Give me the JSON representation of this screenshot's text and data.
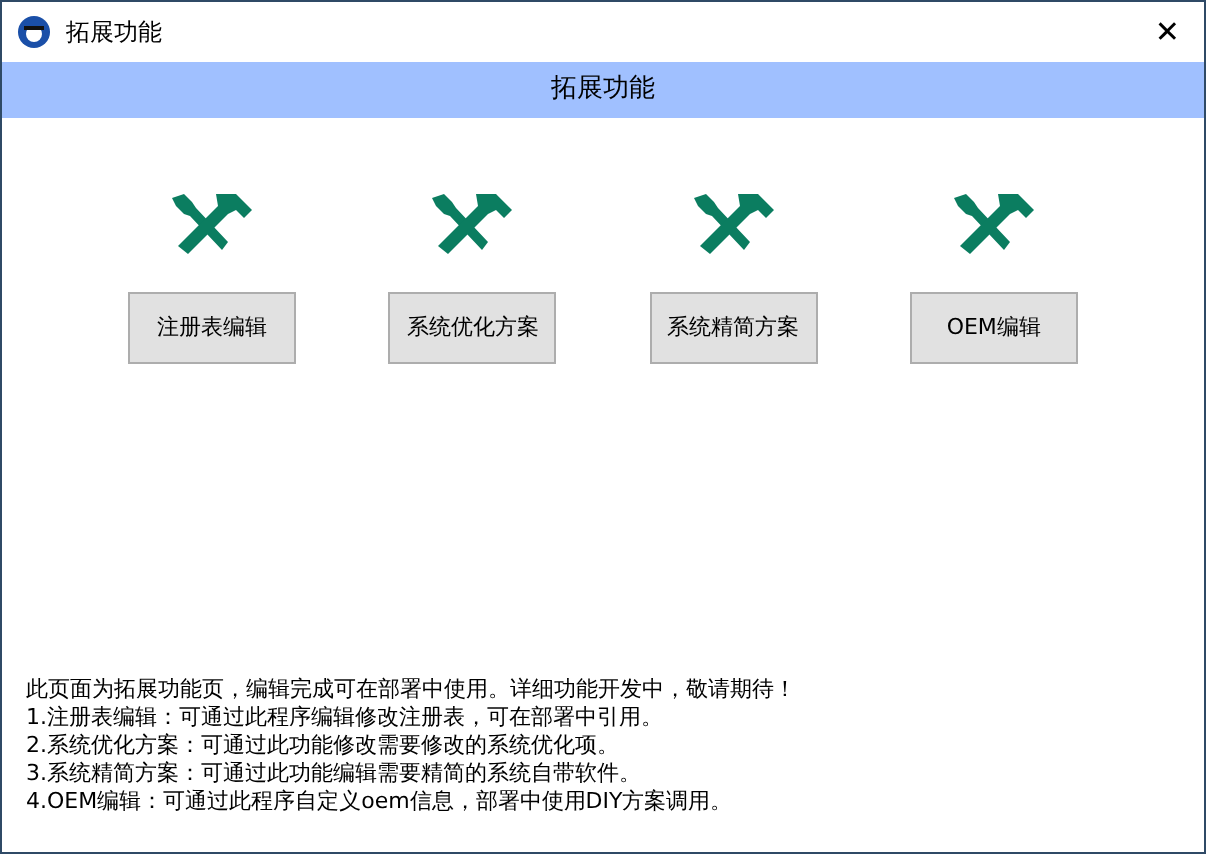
{
  "window": {
    "title": "拓展功能",
    "close": "✕"
  },
  "header": {
    "title": "拓展功能"
  },
  "tools": [
    {
      "label": "注册表编辑"
    },
    {
      "label": "系统优化方案"
    },
    {
      "label": "系统精简方案"
    },
    {
      "label": "OEM编辑"
    }
  ],
  "notes": [
    "此页面为拓展功能页，编辑完成可在部署中使用。详细功能开发中，敬请期待！",
    "1.注册表编辑：可通过此程序编辑修改注册表，可在部署中引用。",
    "2.系统优化方案：可通过此功能修改需要修改的系统优化项。",
    "3.系统精简方案：可通过此功能编辑需要精简的系统自带软件。",
    "4.OEM编辑：可通过此程序自定义oem信息，部署中使用DIY方案调用。"
  ]
}
